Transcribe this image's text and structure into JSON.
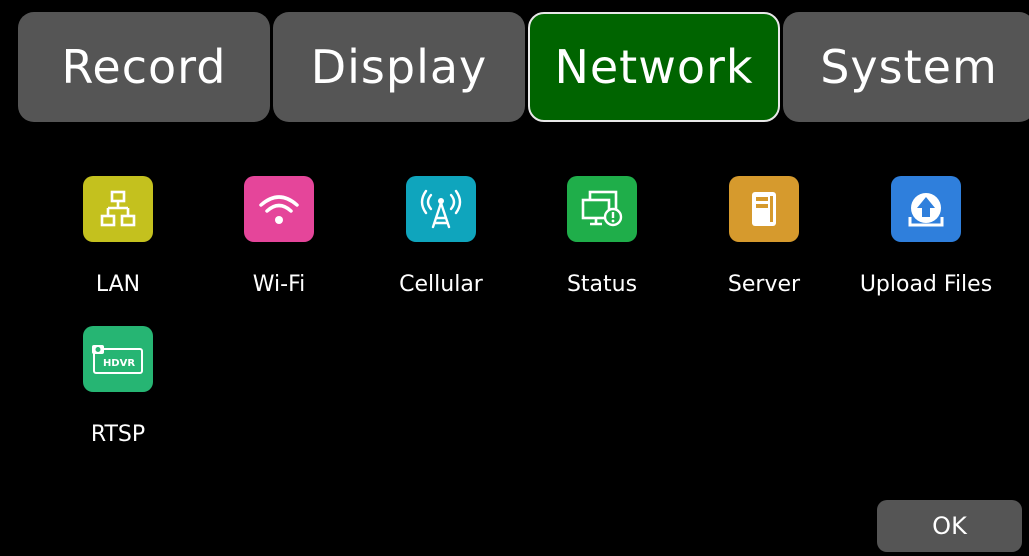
{
  "tabs": [
    {
      "label": "Record",
      "active": false
    },
    {
      "label": "Display",
      "active": false
    },
    {
      "label": "Network",
      "active": true
    },
    {
      "label": "System",
      "active": false
    }
  ],
  "colors": {
    "tab_inactive": "#555555",
    "tab_active": "#006400",
    "background": "#000000"
  },
  "items": [
    {
      "label": "LAN",
      "icon": "lan-network-icon",
      "color": "#c4c11e"
    },
    {
      "label": "Wi-Fi",
      "icon": "wifi-icon",
      "color": "#e5459a"
    },
    {
      "label": "Cellular",
      "icon": "cellular-tower-icon",
      "color": "#0fa5bd"
    },
    {
      "label": "Status",
      "icon": "monitor-status-icon",
      "color": "#1fae4a"
    },
    {
      "label": "Server",
      "icon": "server-icon",
      "color": "#d69a2d"
    },
    {
      "label": "Upload Files",
      "icon": "upload-icon",
      "color": "#2f7fdc"
    },
    {
      "label": "RTSP",
      "icon": "hdvr-camera-icon",
      "color": "#26b573",
      "badge": "HDVR"
    }
  ],
  "ok_label": "OK"
}
